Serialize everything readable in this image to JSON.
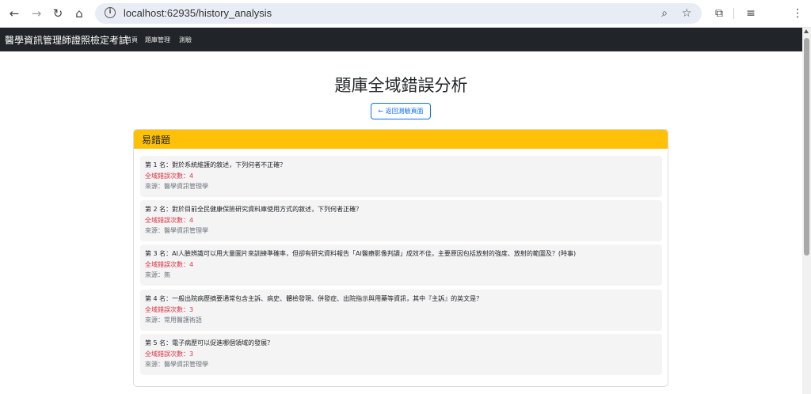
{
  "browser": {
    "url": "localhost:62935/history_analysis"
  },
  "navbar": {
    "brand": "醫學資訊管理師證照檢定考試",
    "links": [
      "首頁",
      "題庫管理",
      "測驗"
    ]
  },
  "page": {
    "title": "題庫全域錯誤分析",
    "back_button": "← 返回測驗頁面"
  },
  "card": {
    "header": "易錯題",
    "items": [
      {
        "question": "第 1 名：對於系統維護的敘述，下列何者不正確？",
        "errors": "全域錯誤次數：4",
        "source": "來源：醫學資訊管理學"
      },
      {
        "question": "第 2 名：對於目前全民健康保險研究資料庫使用方式的敘述，下列何者正確？",
        "errors": "全域錯誤次數：4",
        "source": "來源：醫學資訊管理學"
      },
      {
        "question": "第 3 名：AI人臉辨識可以用大量圖片來訓練準確率，但卻有研究資料報告「AI醫療影像判讀」成效不佳，主要原因包括放射的強度、放射的範圍及？(時事)",
        "errors": "全域錯誤次數：4",
        "source": "來源：無"
      },
      {
        "question": "第 4 名：一般出院病歷摘要通常包含主訴、病史、體檢發現、併發症、出院指示與用藥等資訊，其中『主訴』的英文是？",
        "errors": "全域錯誤次數：3",
        "source": "來源：常用醫護術語"
      },
      {
        "question": "第 5 名：電子病歷可以促進哪個領域的發展？",
        "errors": "全域錯誤次數：3",
        "source": "來源：醫學資訊管理學"
      }
    ]
  }
}
